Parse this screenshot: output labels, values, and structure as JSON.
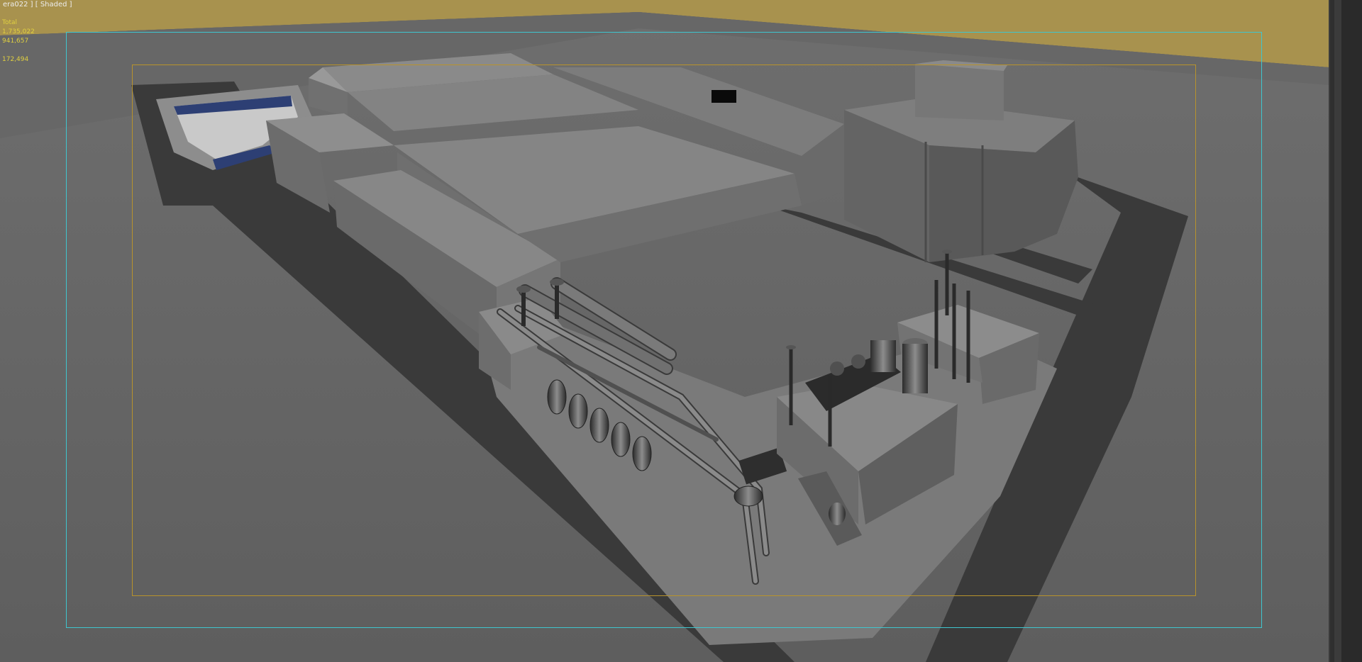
{
  "viewport": {
    "label": "era022 ] [ Shaded ]",
    "stats": {
      "title": "Total",
      "polys": "1,735,022",
      "verts": "941,657",
      "fps": "172,494"
    },
    "colors": {
      "sky": "#a8924e",
      "ground": "#6a6a6a",
      "safe_frame": "#3fc6cf",
      "render_frame": "#b8932c",
      "stats_text": "#e0d040"
    }
  }
}
